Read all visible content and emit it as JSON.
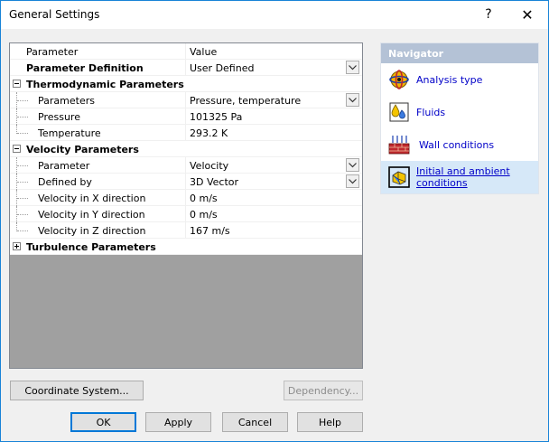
{
  "window": {
    "title": "General Settings",
    "help_glyph": "?",
    "close_glyph": "✕"
  },
  "grid": {
    "header": {
      "name": "Parameter",
      "value": "Value"
    },
    "definition": {
      "name": "Parameter Definition",
      "value": "User Defined"
    },
    "thermo": {
      "label": "Thermodynamic Parameters",
      "rows": [
        {
          "name": "Parameters",
          "value": "Pressure, temperature"
        },
        {
          "name": "Pressure",
          "value": "101325 Pa"
        },
        {
          "name": "Temperature",
          "value": "293.2 K"
        }
      ]
    },
    "velocity": {
      "label": "Velocity Parameters",
      "rows": [
        {
          "name": "Parameter",
          "value": "Velocity"
        },
        {
          "name": "Defined by",
          "value": "3D Vector"
        },
        {
          "name": "Velocity in X direction",
          "value": "0 m/s"
        },
        {
          "name": "Velocity in Y direction",
          "value": "0 m/s"
        },
        {
          "name": "Velocity in Z direction",
          "value": "167 m/s"
        }
      ]
    },
    "turbulence": {
      "label": "Turbulence Parameters"
    }
  },
  "navigator": {
    "title": "Navigator",
    "items": [
      {
        "label": "Analysis type",
        "icon": "analysis-type-icon"
      },
      {
        "label": "Fluids",
        "icon": "fluids-icon"
      },
      {
        "label": "Wall conditions",
        "icon": "wall-conditions-icon"
      },
      {
        "label_line1": "Initial and ambient",
        "label_line2": "conditions",
        "icon": "initial-conditions-icon"
      }
    ]
  },
  "buttons": {
    "coordinate_system": "Coordinate System...",
    "dependency": "Dependency...",
    "ok": "OK",
    "apply": "Apply",
    "cancel": "Cancel",
    "help": "Help"
  },
  "colors": {
    "navigator_header": "#b4c2d6",
    "link": "#0000c8",
    "active_item": "#d6e8f8",
    "window_border": "#1883d7"
  }
}
